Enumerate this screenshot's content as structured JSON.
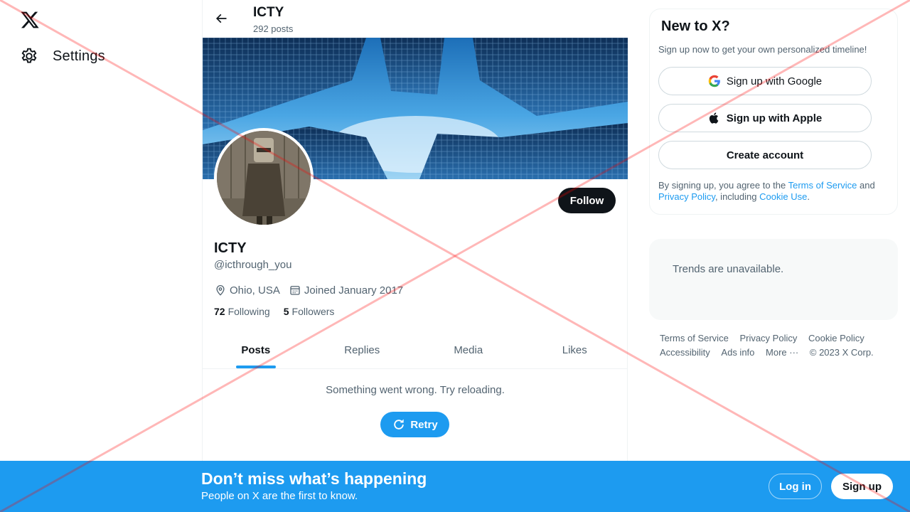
{
  "nav": {
    "logo": "x-logo-icon",
    "settings_label": "Settings"
  },
  "header": {
    "title": "ICTY",
    "posts_count": "292 posts"
  },
  "profile": {
    "follow_label": "Follow",
    "name": "ICTY",
    "handle": "@icthrough_you",
    "location": "Ohio, USA",
    "joined": "Joined January 2017",
    "following_count": "72",
    "following_label": "Following",
    "followers_count": "5",
    "followers_label": "Followers"
  },
  "tabs": [
    {
      "label": "Posts",
      "active": true
    },
    {
      "label": "Replies",
      "active": false
    },
    {
      "label": "Media",
      "active": false
    },
    {
      "label": "Likes",
      "active": false
    }
  ],
  "feed": {
    "error_message": "Something went wrong. Try reloading.",
    "retry_label": "Retry"
  },
  "signup": {
    "title": "New to X?",
    "description": "Sign up now to get your own personalized timeline!",
    "google_label": "Sign up with Google",
    "apple_label": "Sign up with Apple",
    "create_label": "Create account",
    "legal_prefix": "By signing up, you agree to the ",
    "terms_link": "Terms of Service",
    "legal_and": " and ",
    "privacy_link": "Privacy Policy",
    "legal_including": ", including ",
    "cookie_link": "Cookie Use",
    "legal_suffix": "."
  },
  "trends": {
    "message": "Trends are unavailable."
  },
  "footer": {
    "links": [
      "Terms of Service",
      "Privacy Policy",
      "Cookie Policy",
      "Accessibility",
      "Ads info",
      "More ···"
    ],
    "copyright": "© 2023 X Corp."
  },
  "bottom_bar": {
    "headline": "Don’t miss what’s happening",
    "subline": "People on X are the first to know.",
    "login_label": "Log in",
    "signup_label": "Sign up"
  },
  "colors": {
    "accent": "#1d9bf0",
    "text_primary": "#0f1419",
    "text_secondary": "#536471",
    "overlay_x": "#ff0000"
  }
}
